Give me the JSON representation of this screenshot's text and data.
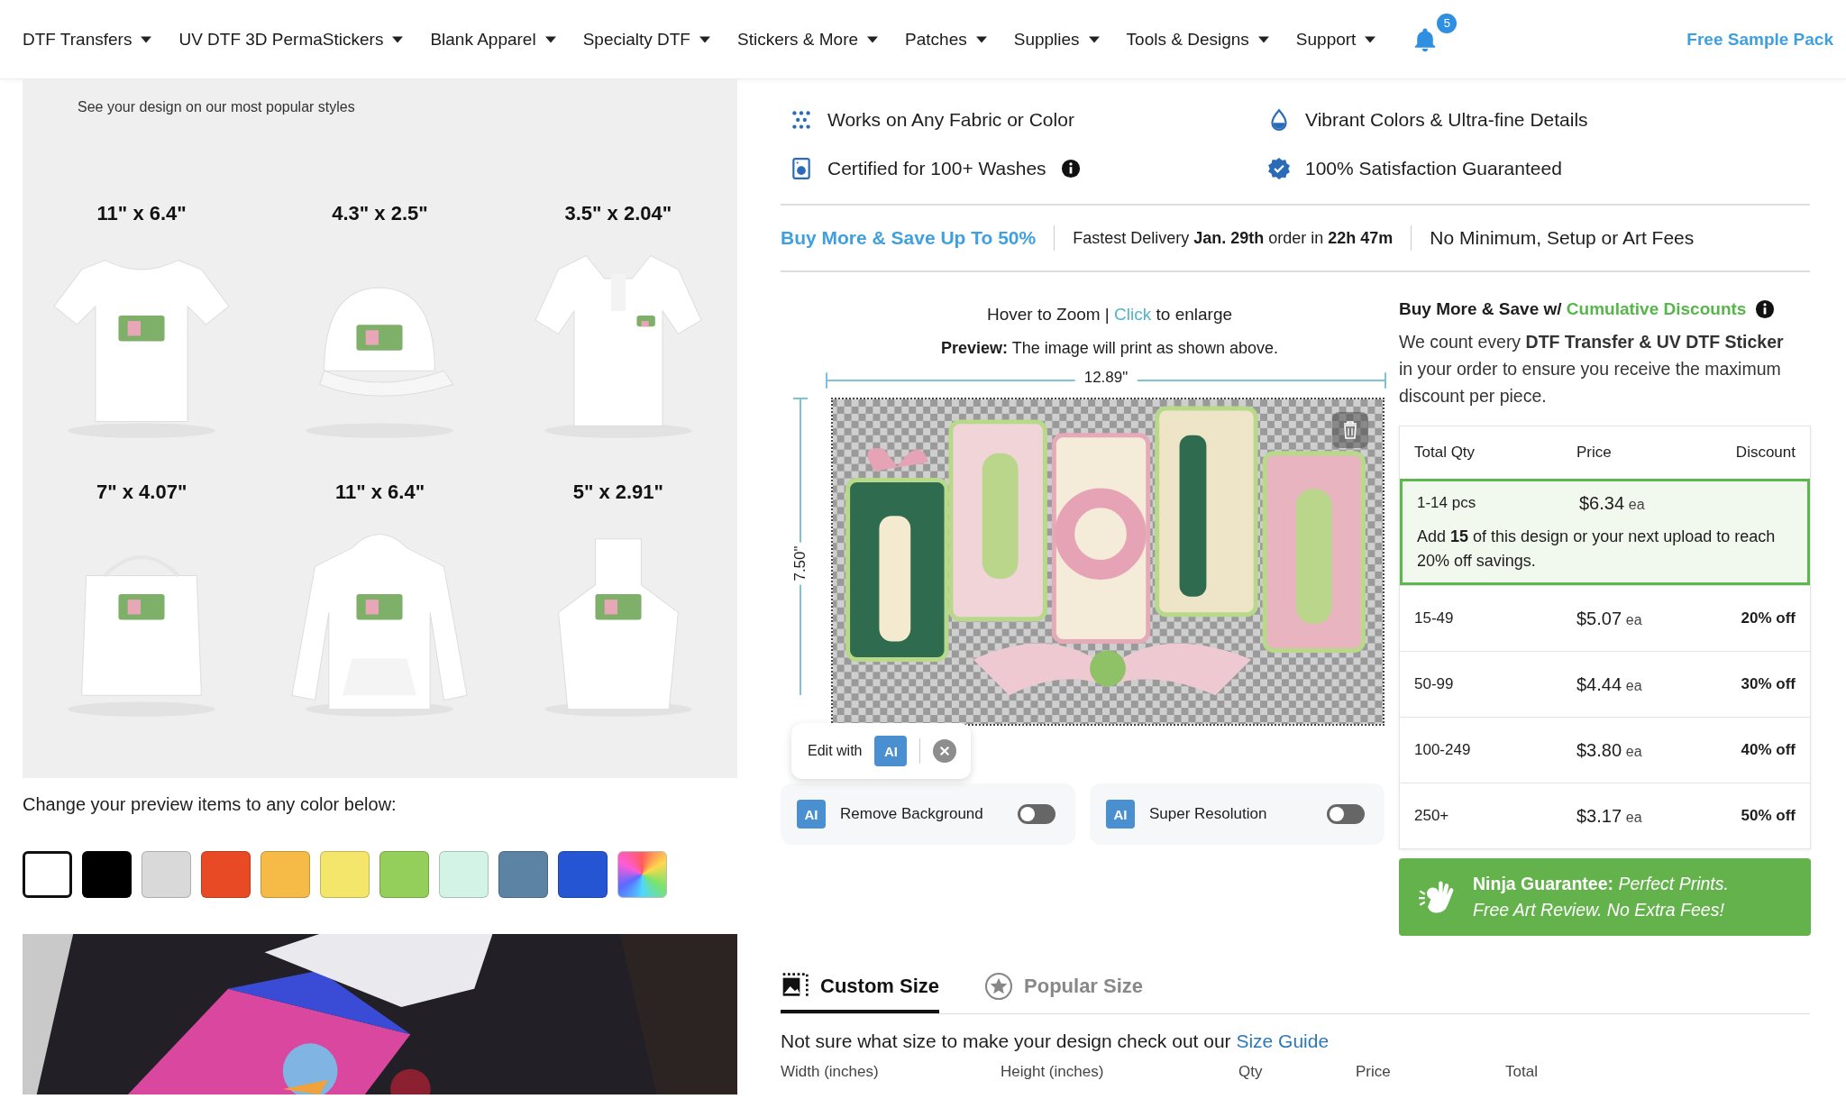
{
  "nav": {
    "items": [
      {
        "label": "DTF Transfers"
      },
      {
        "label": "UV DTF 3D PermaStickers"
      },
      {
        "label": "Blank Apparel"
      },
      {
        "label": "Specialty DTF"
      },
      {
        "label": "Stickers & More"
      },
      {
        "label": "Patches"
      },
      {
        "label": "Supplies"
      },
      {
        "label": "Tools & Designs"
      },
      {
        "label": "Support"
      }
    ],
    "notification_count": "5",
    "cta": "Free Sample Pack"
  },
  "mockups": {
    "hint": "See your design on our most popular styles",
    "items": [
      {
        "size": "11\" x 6.4\""
      },
      {
        "size": "4.3\" x 2.5\""
      },
      {
        "size": "3.5\" x 2.04\""
      },
      {
        "size": "7\" x 4.07\""
      },
      {
        "size": "11\" x 6.4\""
      },
      {
        "size": "5\" x 2.91\""
      }
    ]
  },
  "color_picker": {
    "label": "Change your preview items to any color below:",
    "swatches": [
      {
        "color": "#ffffff",
        "selected": true
      },
      {
        "color": "#000000",
        "selected": false
      },
      {
        "color": "#d9d9d9",
        "selected": false
      },
      {
        "color": "#e94a26",
        "selected": false
      },
      {
        "color": "#f6bb47",
        "selected": false
      },
      {
        "color": "#f4e56b",
        "selected": false
      },
      {
        "color": "#93cf5a",
        "selected": false
      },
      {
        "color": "#d3f3e6",
        "selected": false
      },
      {
        "color": "#5d83a4",
        "selected": false
      },
      {
        "color": "#2555d3",
        "selected": false
      },
      {
        "kind": "rainbow",
        "selected": false
      }
    ]
  },
  "features": [
    "Works on Any Fabric or Color",
    "Vibrant Colors & Ultra-fine Details",
    "Certified for 100+ Washes",
    "100% Satisfaction Guaranteed"
  ],
  "info_strip": {
    "promo": "Buy More & Save Up To 50%",
    "delivery": "Fastest Delivery **Jan. 29th** order in **22h 47m**",
    "fees": "No Minimum, Setup or Art Fees"
  },
  "preview": {
    "hint_before": "Hover to Zoom | ",
    "hint_link": "Click",
    "hint_after": " to enlarge",
    "caption": "**Preview:** The image will print as shown above.",
    "width": "12.89\"",
    "height": "7.50\"",
    "edit_label": "Edit with",
    "ai_badge": "AI",
    "toggles": [
      {
        "badge": "AI",
        "label": "Remove Background",
        "on": false
      },
      {
        "badge": "AI",
        "label": "Super Resolution",
        "on": false
      }
    ]
  },
  "discounts": {
    "heading": "Buy More & Save w/ ",
    "heading_link": "Cumulative Discounts",
    "description": "We count every **DTF Transfer & UV DTF Sticker** in your order to ensure you receive the maximum discount per piece.",
    "columns": [
      "Total Qty",
      "Price",
      "Discount"
    ],
    "rows": [
      {
        "qty": "1-14 pcs",
        "price": "$6.34",
        "unit": "ea",
        "note": "Add **15** of this design or your next upload to reach 20% off savings.",
        "selected": true
      },
      {
        "qty": "15-49",
        "price": "$5.07",
        "unit": "ea",
        "discount": "20% off",
        "selected": false
      },
      {
        "qty": "50-99",
        "price": "$4.44",
        "unit": "ea",
        "discount": "30% off",
        "selected": false
      },
      {
        "qty": "100-249",
        "price": "$3.80",
        "unit": "ea",
        "discount": "40% off",
        "selected": false
      },
      {
        "qty": "250+",
        "price": "$3.17",
        "unit": "ea",
        "discount": "50% off",
        "selected": false
      }
    ],
    "guarantee": "**Ninja Guarantee:** *Perfect Prints. Free Art Review. No Extra Fees!*"
  },
  "size_tabs": [
    {
      "label": "Custom Size",
      "selected": true
    },
    {
      "label": "Popular Size",
      "selected": false
    }
  ],
  "size_guide": {
    "text": "Not sure what size to make your design check out our ",
    "link": "Size Guide"
  },
  "order_columns": [
    "Width (inches)",
    "Height (inches)",
    "Qty",
    "Price",
    "Total"
  ]
}
